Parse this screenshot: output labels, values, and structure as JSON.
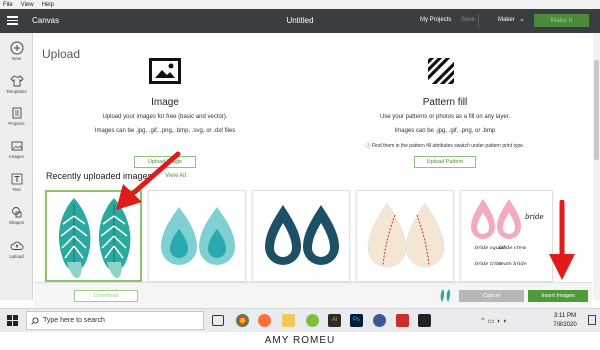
{
  "menu": {
    "items": [
      "File",
      "View",
      "Help"
    ]
  },
  "appbar": {
    "title": "Canvas",
    "doc_title": "Untitled",
    "my_projects": "My Projects",
    "save": "Save",
    "machine": "Maker",
    "make_it": "Make It"
  },
  "sidebar": {
    "items": [
      {
        "label": "New",
        "icon": "plus-icon"
      },
      {
        "label": "Templates",
        "icon": "shirt-icon"
      },
      {
        "label": "Projects",
        "icon": "projects-icon"
      },
      {
        "label": "Images",
        "icon": "image-icon"
      },
      {
        "label": "Text",
        "icon": "text-icon"
      },
      {
        "label": "Shapes",
        "icon": "shapes-icon"
      },
      {
        "label": "Upload",
        "icon": "upload-icon"
      }
    ]
  },
  "upload": {
    "heading": "Upload",
    "image": {
      "title": "Image",
      "desc1": "Upload your images for free (basic and vector).",
      "desc2": "Images can be .jpg, .gif, .png, .bmp, .svg, or .dxf files",
      "button": "Upload Image"
    },
    "pattern": {
      "title": "Pattern fill",
      "desc1": "Use your patterns or photos as a fill on any layer.",
      "desc2": "Images can be .jpg, .gif, .png, or .bmp",
      "note": "ⓘ Find them in the pattern fill attributes swatch under pattern print type.",
      "button": "Upload Pattern"
    },
    "recent_heading": "Recently uploaded images",
    "view_all": "View All",
    "thumbnails": [
      {
        "name": "teal-feather-earrings",
        "selected": true
      },
      {
        "name": "teal-teardrop-earrings",
        "selected": false
      },
      {
        "name": "navy-teardrop-outline-earrings",
        "selected": false
      },
      {
        "name": "baseball-teardrop-earrings",
        "selected": false
      },
      {
        "name": "pink-bride-earrings",
        "selected": false
      }
    ],
    "bride_words": [
      "bride",
      "bride squad",
      "bride crew",
      "bride tribe",
      "team bride"
    ]
  },
  "actions": {
    "download": "Download",
    "cancel": "Cancel",
    "insert": "Insert Images"
  },
  "taskbar": {
    "search_placeholder": "Type here to search",
    "time": "3:11 PM",
    "date": "7/8/2020"
  },
  "credit": "AMY ROMEU",
  "colors": {
    "appbar": "#3a3d42",
    "accent_green": "#4f9a3a",
    "arrow_red": "#e11b1b",
    "teal": "#2aa9a0",
    "navy": "#1d4f66"
  }
}
